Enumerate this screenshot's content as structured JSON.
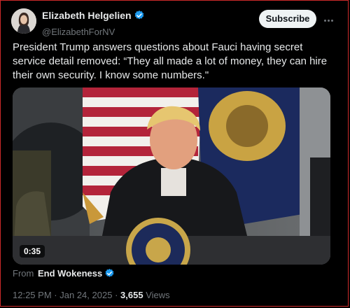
{
  "tweet": {
    "author_name": "Elizabeth Helgelien",
    "author_handle": "@ElizabethForNV",
    "subscribe_label": "Subscribe",
    "text": "President Trump answers questions about Fauci having secret service detail removed: “They all made a lot of money, they can hire their own security. I know some numbers.\"",
    "video_duration": "0:35",
    "from_label": "From",
    "from_source": "End Wokeness",
    "time": "12:25 PM",
    "date": "Jan 24, 2025",
    "views_count": "3,655",
    "views_label": "Views",
    "separator": "·"
  },
  "icons": {
    "verified": "verified-badge-icon",
    "more": "more-dots-icon",
    "play_duration": "video-duration"
  },
  "colors": {
    "background": "#000000",
    "verified_blue": "#1d9bf0",
    "muted": "#71767b",
    "text": "#e7e9ea",
    "subscribe_bg": "#eff3f4"
  }
}
